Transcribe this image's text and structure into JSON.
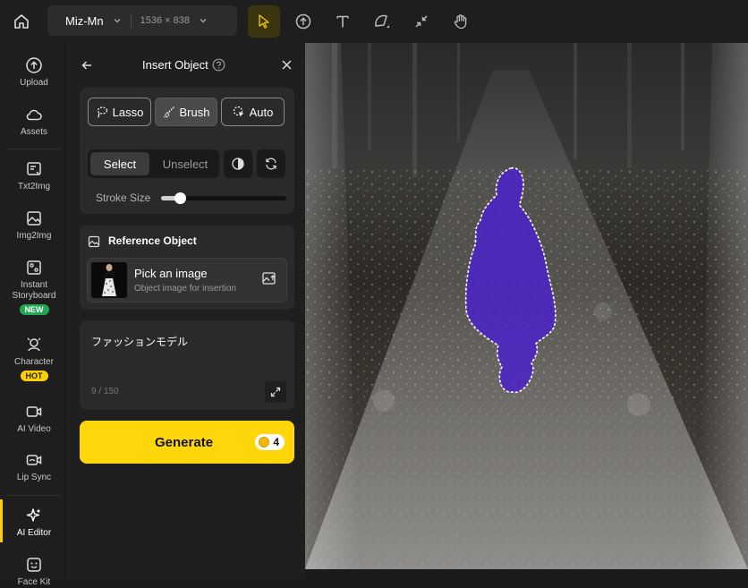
{
  "topbar": {
    "project_name": "Miz-Mn",
    "canvas_size": "1536 × 838",
    "tools": [
      "select-tool",
      "upload-tool",
      "text-tool",
      "shape-tool",
      "fit-tool",
      "hand-tool"
    ]
  },
  "leftnav": {
    "items": [
      {
        "label": "Upload",
        "icon": "upload-icon"
      },
      {
        "label": "Assets",
        "icon": "cloud-icon"
      },
      {
        "label": "Txt2Img",
        "icon": "text-image-icon"
      },
      {
        "label": "Img2Img",
        "icon": "image-icon"
      },
      {
        "label": "Instant Storyboard",
        "icon": "storyboard-icon",
        "badge": "NEW"
      },
      {
        "label": "Character",
        "icon": "character-icon",
        "badge": "HOT"
      },
      {
        "label": "AI Video",
        "icon": "video-icon"
      },
      {
        "label": "Lip Sync",
        "icon": "lip-sync-icon"
      },
      {
        "label": "AI Editor",
        "icon": "sparkle-icon",
        "active": true
      },
      {
        "label": "Face Kit",
        "icon": "face-icon"
      }
    ]
  },
  "panel": {
    "title": "Insert Object",
    "modes": {
      "lasso": "Lasso",
      "brush": "Brush",
      "auto": "Auto",
      "active": "Brush"
    },
    "select_label": "Select",
    "unselect_label": "Unselect",
    "stroke_label": "Stroke Size",
    "stroke_value": 0.15,
    "reference": {
      "title": "Reference Object",
      "main": "Pick an image",
      "sub": "Object image for insertion"
    },
    "prompt": {
      "text": "ファッションモデル",
      "count": "9 / 150"
    },
    "generate": {
      "label": "Generate",
      "credits": "4"
    }
  },
  "colors": {
    "accent": "#ffd60a",
    "mask": "#5a2fd0",
    "active_tool_bg": "#3d3510"
  }
}
